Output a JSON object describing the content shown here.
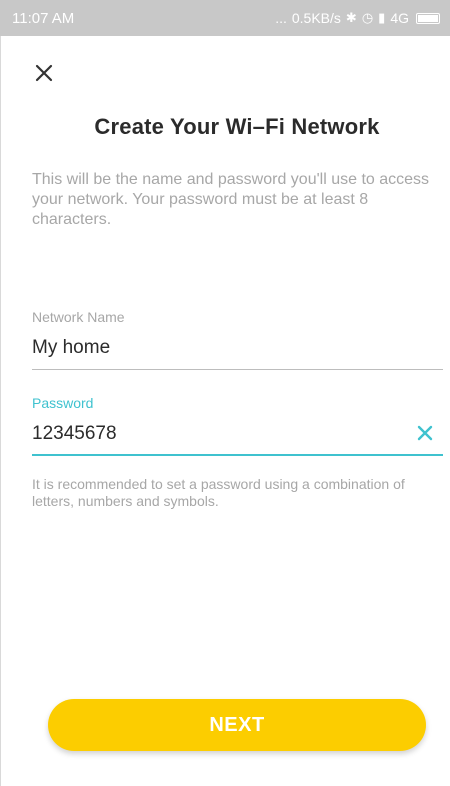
{
  "status_bar": {
    "time": "11:07 AM",
    "dots": "...",
    "speed": "0.5KB/s",
    "network": "4G",
    "icons": [
      "bluetooth-icon",
      "alarm-icon",
      "signal-icon",
      "battery-icon"
    ]
  },
  "header": {
    "title": "Create Your Wi–Fi Network",
    "close_icon": "close-icon"
  },
  "description": "This will be the name and password you'll use to access your network. Your password must be at least 8 characters.",
  "form": {
    "network_name": {
      "label": "Network Name",
      "value": "My home"
    },
    "password": {
      "label": "Password",
      "value": "12345678",
      "clear_icon": "clear-icon"
    }
  },
  "hint": "It is recommended to set a password using a combination of letters, numbers and symbols.",
  "next_label": "NEXT",
  "colors": {
    "accent": "#3fc2cf",
    "button": "#fccd00",
    "status_bar": "#c8c8c8"
  }
}
